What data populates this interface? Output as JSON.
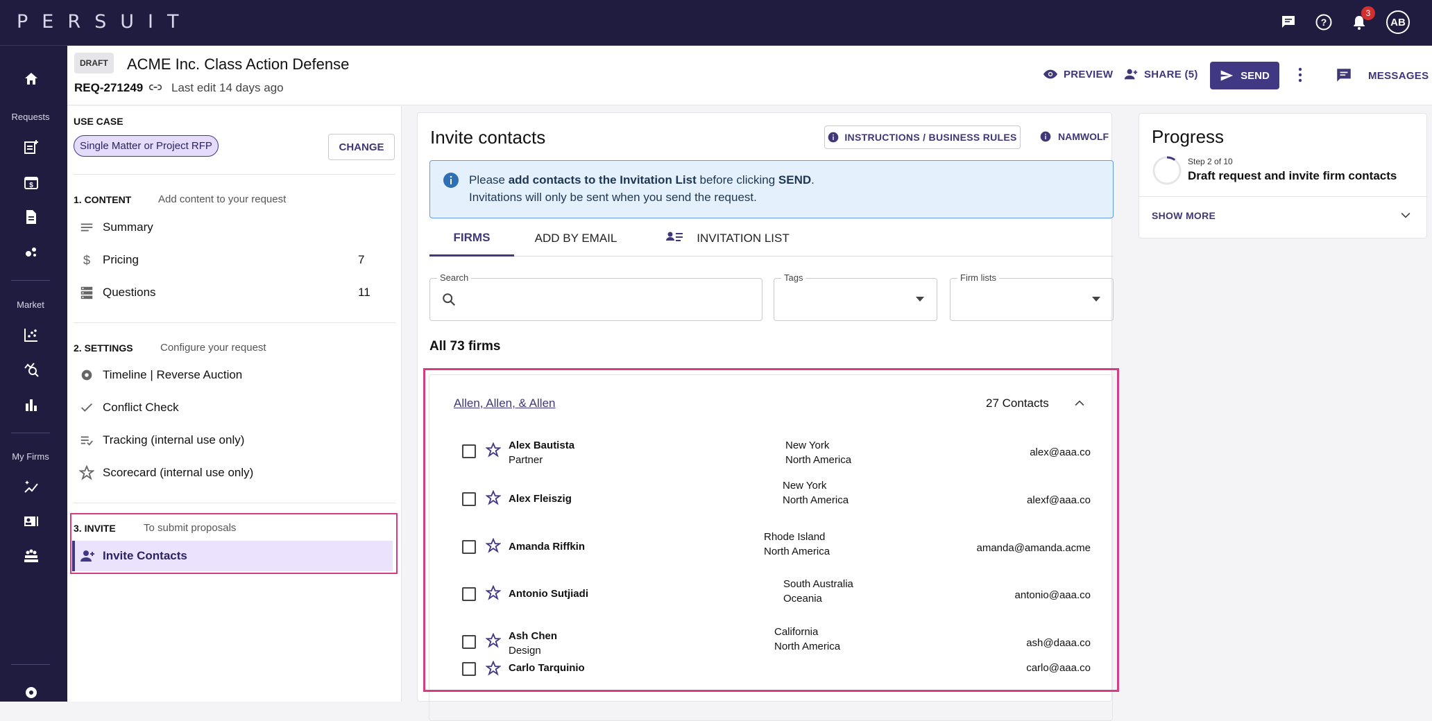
{
  "app": {
    "logo": "PERSUIT",
    "notifications_count": "3",
    "avatar_initials": "AB"
  },
  "nav": {
    "requests_label": "Requests",
    "market_label": "Market",
    "myfirms_label": "My Firms"
  },
  "header": {
    "status_badge": "DRAFT",
    "title": "ACME Inc. Class Action Defense",
    "request_id": "REQ-271249",
    "last_edit": "Last edit 14 days ago",
    "preview_label": "PREVIEW",
    "share_label": "SHARE (5)",
    "send_label": "SEND",
    "messages_label": "MESSAGES"
  },
  "sidebar": {
    "use_case_title": "USE CASE",
    "use_case_value": "Single Matter or Project RFP",
    "change_label": "CHANGE",
    "content_title": "1. CONTENT",
    "content_sub": "Add content to your request",
    "content_items": [
      {
        "label": "Summary",
        "count": ""
      },
      {
        "label": "Pricing",
        "count": "7"
      },
      {
        "label": "Questions",
        "count": "11"
      }
    ],
    "settings_title": "2. SETTINGS",
    "settings_sub": "Configure your request",
    "settings_items": [
      {
        "label": "Timeline | Reverse Auction"
      },
      {
        "label": "Conflict Check"
      },
      {
        "label": "Tracking (internal use only)"
      },
      {
        "label": "Scorecard (internal use only)"
      }
    ],
    "invite_title": "3. INVITE",
    "invite_sub": "To submit proposals",
    "invite_item": "Invite Contacts"
  },
  "main": {
    "title": "Invite contacts",
    "instructions_label": "INSTRUCTIONS / BUSINESS RULES",
    "namwolf_label": "NAMWOLF",
    "info": {
      "pre": "Please ",
      "bold1": "add contacts to the Invitation List",
      "mid": " before clicking ",
      "bold2": "SEND",
      "post": ".",
      "line2": "Invitations will only be sent when you send the request."
    },
    "tabs": [
      "FIRMS",
      "ADD BY EMAIL",
      "INVITATION LIST"
    ],
    "search_label": "Search",
    "tags_label": "Tags",
    "firmlists_label": "Firm lists",
    "all_firms": "All 73 firms",
    "firm": {
      "name": "Allen, Allen, & Allen",
      "contacts_count": "27 Contacts",
      "contacts": [
        {
          "name": "Alex Bautista",
          "title": "Partner",
          "loc1": "New York",
          "loc2": "North America",
          "email": "alex@aaa.co"
        },
        {
          "name": "Alex Fleiszig",
          "title": "",
          "loc1": "New York",
          "loc2": "North America",
          "email": "alexf@aaa.co"
        },
        {
          "name": "Amanda Riffkin",
          "title": "",
          "loc1": "Rhode Island",
          "loc2": "North America",
          "email": "amanda@amanda.acme"
        },
        {
          "name": "Antonio Sutjiadi",
          "title": "",
          "loc1": "South Australia",
          "loc2": "Oceania",
          "email": "antonio@aaa.co"
        },
        {
          "name": "Ash Chen",
          "title": "Design",
          "loc1": "California",
          "loc2": "North America",
          "email": "ash@daaa.co"
        },
        {
          "name": "Carlo Tarquinio",
          "title": "",
          "loc1": "",
          "loc2": "",
          "email": "carlo@aaa.co"
        }
      ]
    }
  },
  "progress": {
    "title": "Progress",
    "step": "Step 2 of 10",
    "description": "Draft request and invite firm contacts",
    "show_more": "SHOW MORE"
  },
  "colors": {
    "brand_dark": "#201c3f",
    "accent": "#403883",
    "highlight": "#d63c82",
    "info_bg": "#e4f1fd"
  }
}
